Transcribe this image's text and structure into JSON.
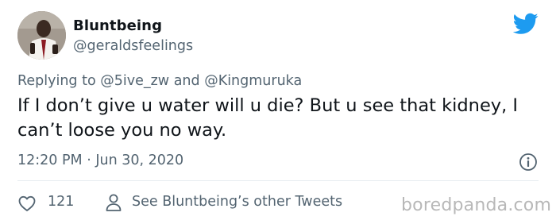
{
  "author": {
    "display_name": "Bluntbeing",
    "handle": "@geraldsfeelings"
  },
  "reply": {
    "prefix": "Replying to",
    "mention_1": "@5ive_zw",
    "connector": "and",
    "mention_2": "@Kingmuruka"
  },
  "tweet": {
    "text": "If I don’t give u water will u die? But u see that kidney, I can’t loose you no way.",
    "timestamp": "12:20 PM · Jun 30, 2020"
  },
  "actions": {
    "like_count": "121",
    "other_tweets_label": "See Bluntbeing’s other Tweets"
  },
  "watermark": "boredpanda.com",
  "icons": {
    "brand": "twitter-bird-icon",
    "info": "info-icon",
    "like": "heart-icon",
    "profile": "person-icon"
  },
  "colors": {
    "twitter_blue": "#1d9bf0",
    "text_primary": "#0f1419",
    "text_secondary": "#536471",
    "watermark": "#b8b8b8"
  }
}
